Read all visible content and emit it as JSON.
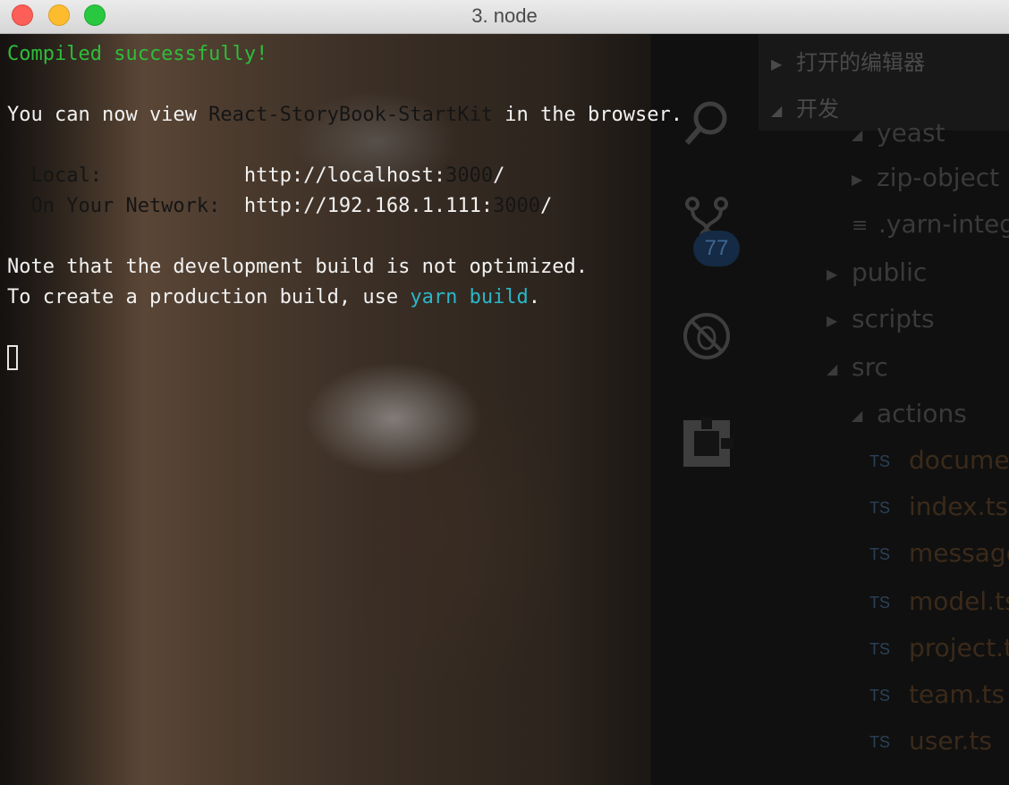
{
  "window": {
    "title": "3. node"
  },
  "terminal": {
    "compiled": "Compiled successfully!",
    "view_prefix": "You can now view ",
    "app_name": "React-StoryBook-StartKit",
    "view_suffix": " in the browser.",
    "local_label": "  Local:            ",
    "local_url": "http://localhost:",
    "local_port": "3000",
    "local_slash": "/",
    "network_label": "  On Your Network:  ",
    "network_url": "http://192.168.1.111:",
    "network_port": "3000",
    "network_slash": "/",
    "note": "Note that the development build is not optimized.",
    "prod_prefix": "To create a production build, use ",
    "prod_cmd": "yarn build",
    "prod_suffix": "."
  },
  "activity_bar": {
    "scm_badge": "77"
  },
  "explorer": {
    "open_editors": "打开的编辑器",
    "dev_section": "开发",
    "items": [
      {
        "label": "yeast",
        "kind": "folder"
      },
      {
        "label": "zip-object",
        "kind": "folder"
      },
      {
        "label": ".yarn-integrity",
        "kind": "file"
      },
      {
        "label": "public",
        "kind": "folder"
      },
      {
        "label": "scripts",
        "kind": "folder"
      },
      {
        "label": "src",
        "kind": "folder-open"
      },
      {
        "label": "actions",
        "kind": "folder-open"
      }
    ],
    "ts_files": [
      {
        "badge": "TS",
        "label": "document.ts"
      },
      {
        "badge": "TS",
        "label": "index.ts"
      },
      {
        "badge": "TS",
        "label": "message.ts"
      },
      {
        "badge": "TS",
        "label": "model.ts"
      },
      {
        "badge": "TS",
        "label": "project.ts"
      },
      {
        "badge": "TS",
        "label": "team.ts"
      },
      {
        "badge": "TS",
        "label": "user.ts"
      }
    ]
  },
  "colors": {
    "success": "#2ebd3a",
    "command": "#2bb7c9",
    "close": "#fc5f57",
    "minimize": "#fdbc2e",
    "maximize": "#28c840"
  }
}
